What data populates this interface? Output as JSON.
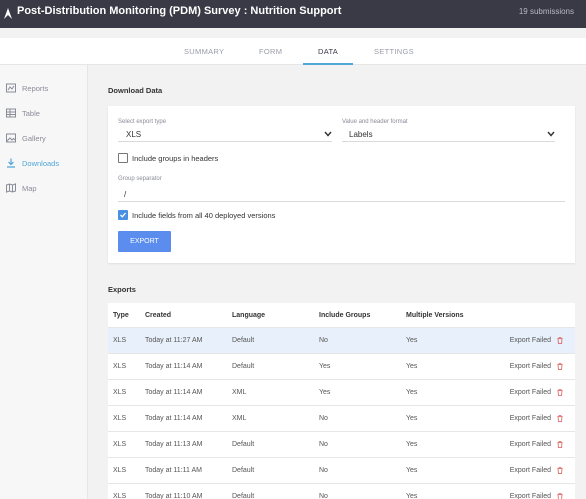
{
  "header": {
    "title": "Post-Distribution Monitoring (PDM) Survey : Nutrition Support",
    "submissions": "19 submissions"
  },
  "tabs": [
    {
      "label": "SUMMARY"
    },
    {
      "label": "FORM"
    },
    {
      "label": "DATA"
    },
    {
      "label": "SETTINGS"
    }
  ],
  "sidebar": {
    "items": [
      {
        "label": "Reports",
        "icon": "reports-icon"
      },
      {
        "label": "Table",
        "icon": "table-icon"
      },
      {
        "label": "Gallery",
        "icon": "gallery-icon"
      },
      {
        "label": "Downloads",
        "icon": "download-icon"
      },
      {
        "label": "Map",
        "icon": "map-icon"
      }
    ]
  },
  "download": {
    "title": "Download Data",
    "export_type_label": "Select export type",
    "export_type_value": "XLS",
    "format_label": "Value and header format",
    "format_value": "Labels",
    "include_groups_label": "Include groups in headers",
    "include_groups_checked": false,
    "separator_label": "Group separator",
    "separator_value": "/",
    "include_versions_label": "Include fields from all 40 deployed versions",
    "include_versions_checked": true,
    "export_button": "EXPORT"
  },
  "exports": {
    "title": "Exports",
    "columns": [
      "Type",
      "Created",
      "Language",
      "Include Groups",
      "Multiple Versions"
    ],
    "rows": [
      {
        "type": "XLS",
        "created": "Today at 11:27 AM",
        "language": "Default",
        "groups": "No",
        "versions": "Yes",
        "status": "Export Failed"
      },
      {
        "type": "XLS",
        "created": "Today at 11:14 AM",
        "language": "Default",
        "groups": "Yes",
        "versions": "Yes",
        "status": "Export Failed"
      },
      {
        "type": "XLS",
        "created": "Today at 11:14 AM",
        "language": "XML",
        "groups": "Yes",
        "versions": "Yes",
        "status": "Export Failed"
      },
      {
        "type": "XLS",
        "created": "Today at 11:14 AM",
        "language": "XML",
        "groups": "No",
        "versions": "Yes",
        "status": "Export Failed"
      },
      {
        "type": "XLS",
        "created": "Today at 11:13 AM",
        "language": "Default",
        "groups": "No",
        "versions": "Yes",
        "status": "Export Failed"
      },
      {
        "type": "XLS",
        "created": "Today at 11:11 AM",
        "language": "Default",
        "groups": "No",
        "versions": "Yes",
        "status": "Export Failed"
      },
      {
        "type": "XLS",
        "created": "Today at 11:10 AM",
        "language": "Default",
        "groups": "No",
        "versions": "Yes",
        "status": "Export Failed"
      }
    ]
  },
  "colors": {
    "header_bg": "#3a3a46",
    "accent": "#4fa7d8",
    "button": "#5b8def",
    "failed_icon": "#e05a5a"
  }
}
